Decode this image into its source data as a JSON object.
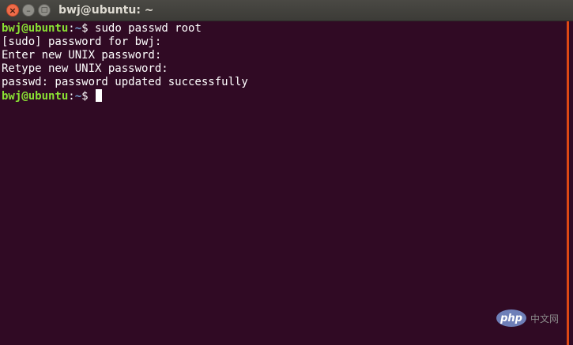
{
  "window": {
    "title": "bwj@ubuntu: ~",
    "controls": {
      "close": "×",
      "minimize": "–",
      "maximize": "□"
    }
  },
  "terminal": {
    "line1": {
      "user": "bwj@ubuntu",
      "colon": ":",
      "path": "~",
      "prompt": "$ ",
      "command": "sudo passwd root"
    },
    "line2": "[sudo] password for bwj:",
    "line3": "Enter new UNIX password:",
    "line4": "Retype new UNIX password:",
    "line5": "passwd: password updated successfully",
    "line6": {
      "user": "bwj@ubuntu",
      "colon": ":",
      "path": "~",
      "prompt": "$ "
    }
  },
  "watermark": {
    "logo": "php",
    "text": "中文网"
  },
  "colors": {
    "background": "#300a24",
    "user": "#8ae234",
    "path": "#729fcf",
    "text": "#ffffff",
    "scrollbar": "#dd4814",
    "close_button": "#ef6c49"
  },
  "icons": [
    "close-icon",
    "minimize-icon",
    "maximize-icon"
  ]
}
